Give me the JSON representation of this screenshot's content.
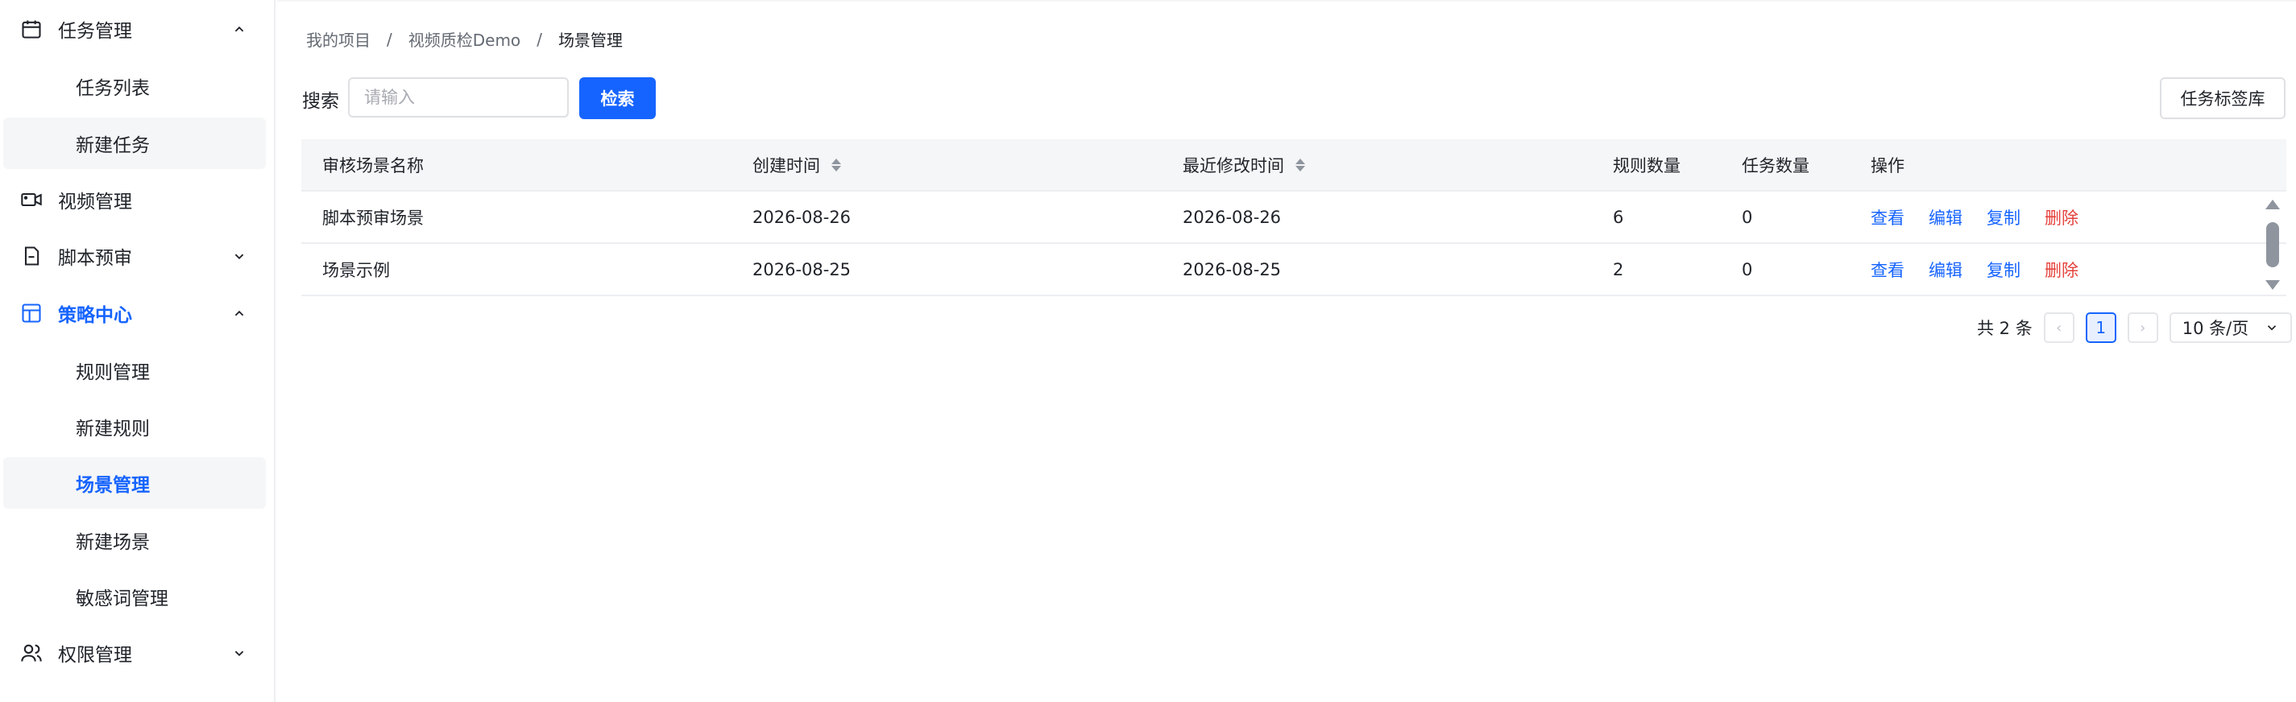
{
  "sidebar": {
    "items": [
      {
        "label": "任务管理",
        "icon": "calendar-icon",
        "expanded": true
      },
      {
        "label": "任务列表"
      },
      {
        "label": "新建任务",
        "highlighted": true
      },
      {
        "label": "视频管理",
        "icon": "video-icon"
      },
      {
        "label": "脚本预审",
        "icon": "document-icon",
        "expanded": false
      },
      {
        "label": "策略中心",
        "icon": "layout-icon",
        "expanded": true,
        "active": true
      },
      {
        "label": "规则管理"
      },
      {
        "label": "新建规则"
      },
      {
        "label": "场景管理",
        "active": true
      },
      {
        "label": "新建场景"
      },
      {
        "label": "敏感词管理"
      },
      {
        "label": "权限管理",
        "icon": "users-icon",
        "expanded": false
      }
    ]
  },
  "breadcrumb": {
    "items": [
      "我的项目",
      "视频质检Demo",
      "场景管理"
    ],
    "separator": "/"
  },
  "search": {
    "label": "搜索",
    "placeholder": "请输入",
    "value": "",
    "button": "检索"
  },
  "toolbar": {
    "tag_library_button": "任务标签库"
  },
  "table": {
    "headers": [
      "审核场景名称",
      "创建时间",
      "最近修改时间",
      "规则数量",
      "任务数量",
      "操作"
    ],
    "rows": [
      {
        "name": "脚本预审场景",
        "created": "2026-08-26",
        "modified": "2026-08-26",
        "rules": "6",
        "tasks": "0"
      },
      {
        "name": "场景示例",
        "created": "2026-08-25",
        "modified": "2026-08-25",
        "rules": "2",
        "tasks": "0"
      }
    ],
    "actions": {
      "view": "查看",
      "edit": "编辑",
      "copy": "复制",
      "delete": "删除"
    }
  },
  "pagination": {
    "total_text": "共 2 条",
    "current_page": "1",
    "page_size": "10 条/页",
    "prev_icon": "chevron-left-icon",
    "next_icon": "chevron-right-icon"
  },
  "colors": {
    "accent": "#1664ff",
    "danger": "#e5413b",
    "text": "#1f2329",
    "muted": "#646a73"
  }
}
